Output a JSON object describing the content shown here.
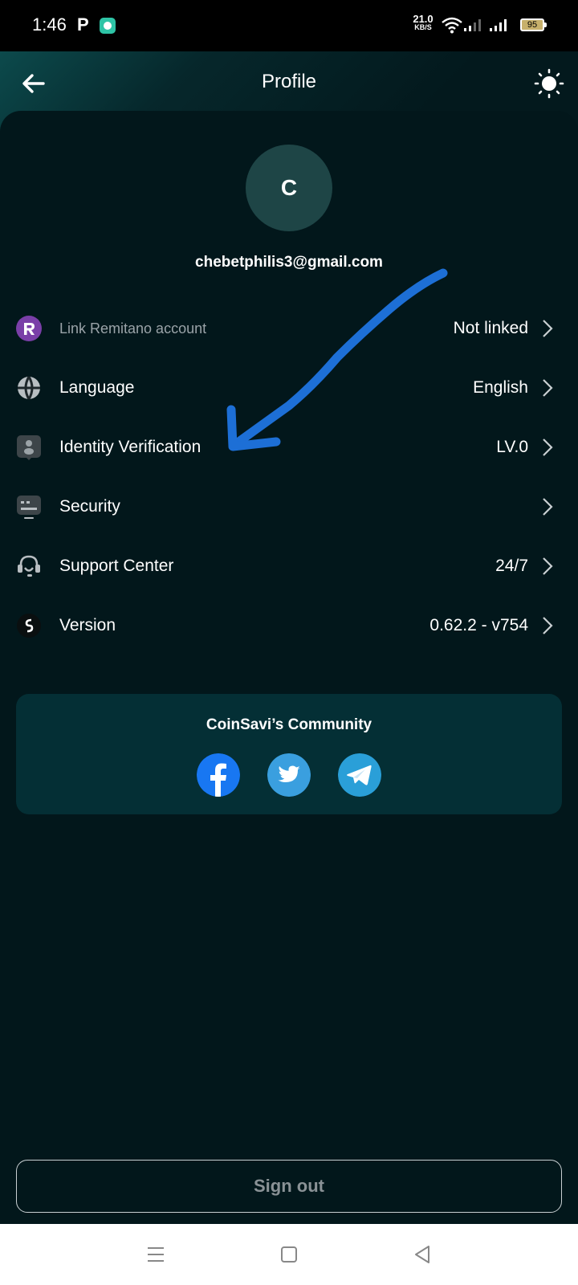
{
  "status_bar": {
    "time": "1:46",
    "carrier_glyph": "P",
    "net_speed_value": "21.0",
    "net_speed_unit": "KB/S",
    "battery": "95",
    "icons": [
      "p-app-icon",
      "chat-app-icon",
      "wifi-icon",
      "signal-icon",
      "signal-icon",
      "battery-icon"
    ]
  },
  "header": {
    "title": "Profile",
    "back_icon": "arrow-left-icon",
    "theme_icon": "sun-icon"
  },
  "profile": {
    "avatar_initial": "C",
    "email": "chebetphilis3@gmail.com"
  },
  "menu": [
    {
      "label": "Link Remitano account",
      "value": "Not linked",
      "icon": "remitano-icon"
    },
    {
      "label": "Language",
      "value": "English",
      "icon": "globe-icon"
    },
    {
      "label": "Identity Verification",
      "value": "LV.0",
      "icon": "id-badge-icon"
    },
    {
      "label": "Security",
      "value": "",
      "icon": "security-icon"
    },
    {
      "label": "Support Center",
      "value": "24/7",
      "icon": "headset-icon"
    },
    {
      "label": "Version",
      "value": "0.62.2 - v754",
      "icon": "coinsavi-icon"
    }
  ],
  "community": {
    "title": "CoinSavi’s Community",
    "links": [
      "facebook-icon",
      "twitter-icon",
      "telegram-icon"
    ]
  },
  "sign_out_label": "Sign out",
  "colors": {
    "background": "#02171b",
    "card": "#042f35",
    "avatar": "#1e4546",
    "annotation_arrow": "#1d6fd6"
  },
  "nav_bar": [
    "menu-icon",
    "home-square-icon",
    "back-triangle-icon"
  ]
}
